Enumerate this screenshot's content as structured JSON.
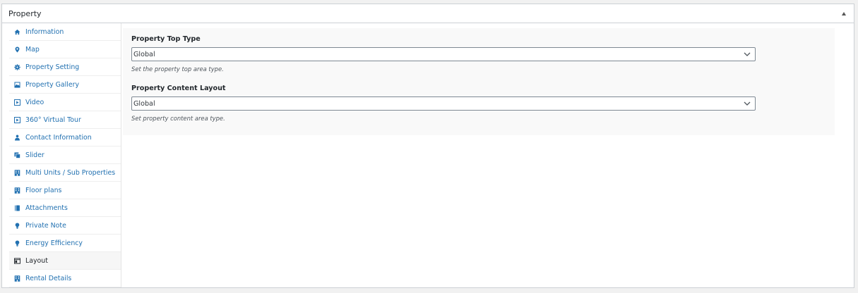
{
  "panel": {
    "title": "Property"
  },
  "tabs": [
    {
      "label": "Information",
      "icon": "home-icon"
    },
    {
      "label": "Map",
      "icon": "map-pin-icon"
    },
    {
      "label": "Property Setting",
      "icon": "gear-icon"
    },
    {
      "label": "Property Gallery",
      "icon": "gallery-icon"
    },
    {
      "label": "Video",
      "icon": "video-icon"
    },
    {
      "label": "360° Virtual Tour",
      "icon": "virtual-tour-icon"
    },
    {
      "label": "Contact Information",
      "icon": "contact-icon"
    },
    {
      "label": "Slider",
      "icon": "slider-icon"
    },
    {
      "label": "Multi Units / Sub Properties",
      "icon": "building-icon"
    },
    {
      "label": "Floor plans",
      "icon": "floorplan-icon"
    },
    {
      "label": "Attachments",
      "icon": "attachment-icon"
    },
    {
      "label": "Private Note",
      "icon": "bulb-icon"
    },
    {
      "label": "Energy Efficiency",
      "icon": "energy-icon"
    },
    {
      "label": "Layout",
      "icon": "layout-icon",
      "active": true
    },
    {
      "label": "Rental Details",
      "icon": "rental-icon"
    }
  ],
  "fields": {
    "top_type": {
      "label": "Property Top Type",
      "value": "Global",
      "description": "Set the property top area type."
    },
    "content_layout": {
      "label": "Property Content Layout",
      "value": "Global",
      "description": "Set property content area type."
    }
  },
  "colors": {
    "link": "#2271b1",
    "active_tab_bg": "#f6f6f6",
    "content_bg": "#f9f9f9"
  }
}
